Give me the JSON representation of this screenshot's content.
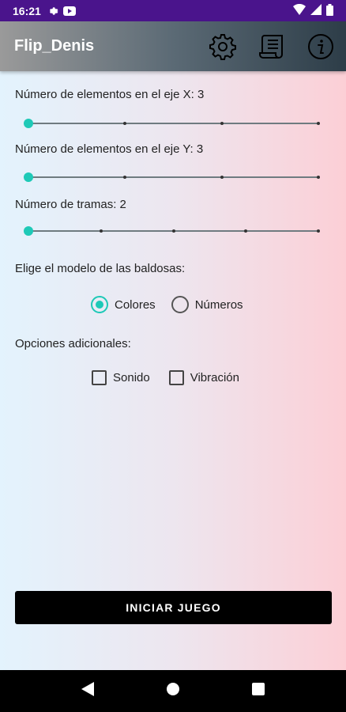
{
  "status_bar": {
    "time": "16:21",
    "icons": [
      "settings-gear-icon",
      "youtube-icon",
      "wifi-icon",
      "signal-icon",
      "battery-icon"
    ]
  },
  "app_bar": {
    "title": "Flip_Denis",
    "actions": [
      "settings-icon",
      "scroll-icon",
      "info-icon"
    ]
  },
  "settings": {
    "x_label": "Número de elementos en el eje X: 3",
    "x_slider": {
      "min": 3,
      "max": 6,
      "value": 3
    },
    "y_label": "Número de elementos en el eje Y: 3",
    "y_slider": {
      "min": 3,
      "max": 6,
      "value": 3
    },
    "frames_label": "Número de tramas: 2",
    "frames_slider": {
      "min": 2,
      "max": 6,
      "value": 2
    },
    "model_label": "Elige el modelo de las baldosas:",
    "model_options": [
      {
        "label": "Colores",
        "selected": true
      },
      {
        "label": "Números",
        "selected": false
      }
    ],
    "extra_label": "Opciones adicionales:",
    "extra_options": [
      {
        "label": "Sonido",
        "checked": false
      },
      {
        "label": "Vibración",
        "checked": false
      }
    ]
  },
  "start_button": "INICIAR JUEGO",
  "colors": {
    "accent": "#1ec9b7",
    "status_bar": "#4a148c",
    "button": "#000000"
  }
}
